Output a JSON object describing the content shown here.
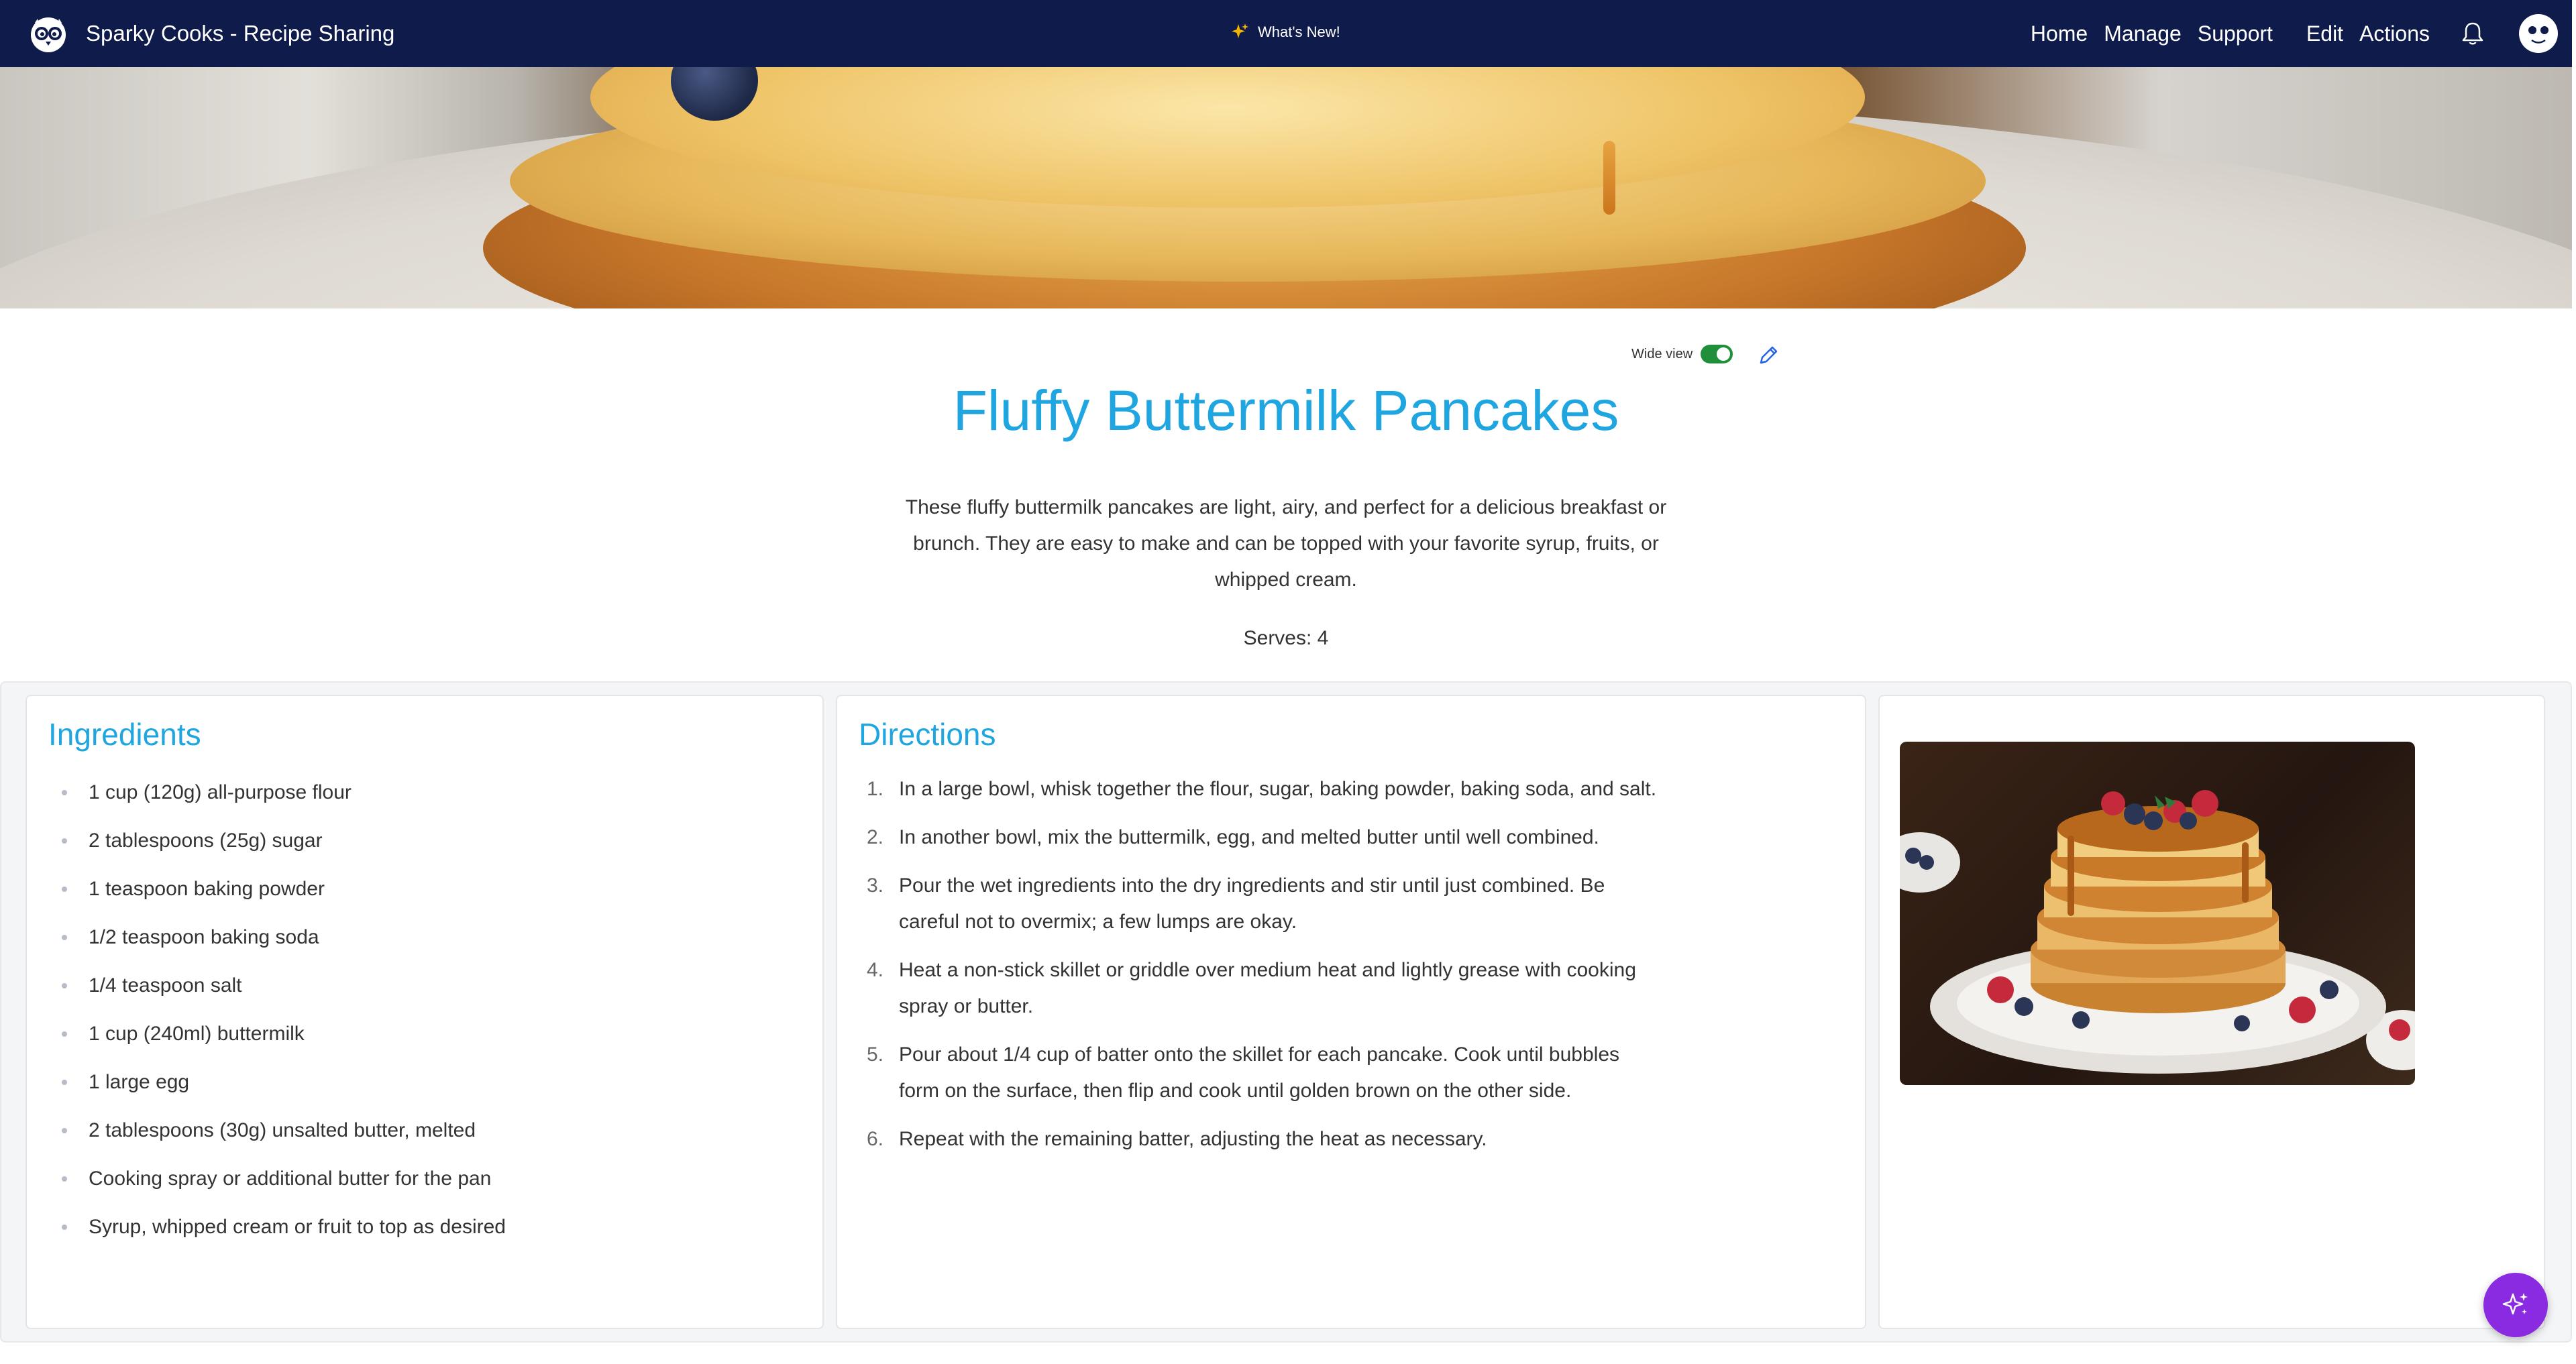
{
  "app": {
    "title": "Sparky Cooks - Recipe Sharing",
    "logo_icon": "owl-logo-icon"
  },
  "header": {
    "whats_new_label": "What's New!",
    "nav_items": [
      {
        "label": "Home"
      },
      {
        "label": "Manage"
      },
      {
        "label": "Support"
      },
      {
        "label": "Edit"
      },
      {
        "label": "Actions"
      }
    ],
    "notification_icon": "bell-icon",
    "avatar_icon": "avatar-icon",
    "colors": {
      "background": "#0f1b4a",
      "text": "#ffffff"
    }
  },
  "toolbar": {
    "wide_view_label": "Wide view",
    "wide_view_enabled": true,
    "edit_icon": "pencil-icon"
  },
  "recipe": {
    "title": "Fluffy Buttermilk Pancakes",
    "description": "These fluffy buttermilk pancakes are light, airy, and perfect for a delicious breakfast or brunch. They are easy to make and can be topped with your favorite syrup, fruits, or whipped cream.",
    "serves": "Serves: 4",
    "accent_color": "#1fa6e0"
  },
  "ingredients": {
    "heading": "Ingredients",
    "items": [
      "1 cup (120g) all-purpose flour",
      "2 tablespoons (25g) sugar",
      "1 teaspoon baking powder",
      "1/2 teaspoon baking soda",
      "1/4 teaspoon salt",
      "1 cup (240ml) buttermilk",
      "1 large egg",
      "2 tablespoons (30g) unsalted butter, melted",
      "Cooking spray or additional butter for the pan",
      "Syrup, whipped cream or fruit to top as desired"
    ]
  },
  "directions": {
    "heading": "Directions",
    "steps": [
      {
        "num": "1.",
        "text": "In a large bowl, whisk together the flour, sugar, baking powder, baking soda, and salt."
      },
      {
        "num": "2.",
        "text": "In another bowl, mix the buttermilk, egg, and melted butter until well combined."
      },
      {
        "num": "3.",
        "text": "Pour the wet ingredients into the dry ingredients and stir until just combined. Be careful not to overmix; a few lumps are okay."
      },
      {
        "num": "4.",
        "text": "Heat a non-stick skillet or griddle over medium heat and lightly grease with cooking spray or butter."
      },
      {
        "num": "5.",
        "text": "Pour about 1/4 cup of batter onto the skillet for each pancake. Cook until bubbles form on the surface, then flip and cook until golden brown on the other side."
      },
      {
        "num": "6.",
        "text": "Repeat with the remaining batter, adjusting the heat as necessary."
      }
    ]
  },
  "fab": {
    "icon": "sparkle-icon",
    "color": "#8a2be2"
  }
}
